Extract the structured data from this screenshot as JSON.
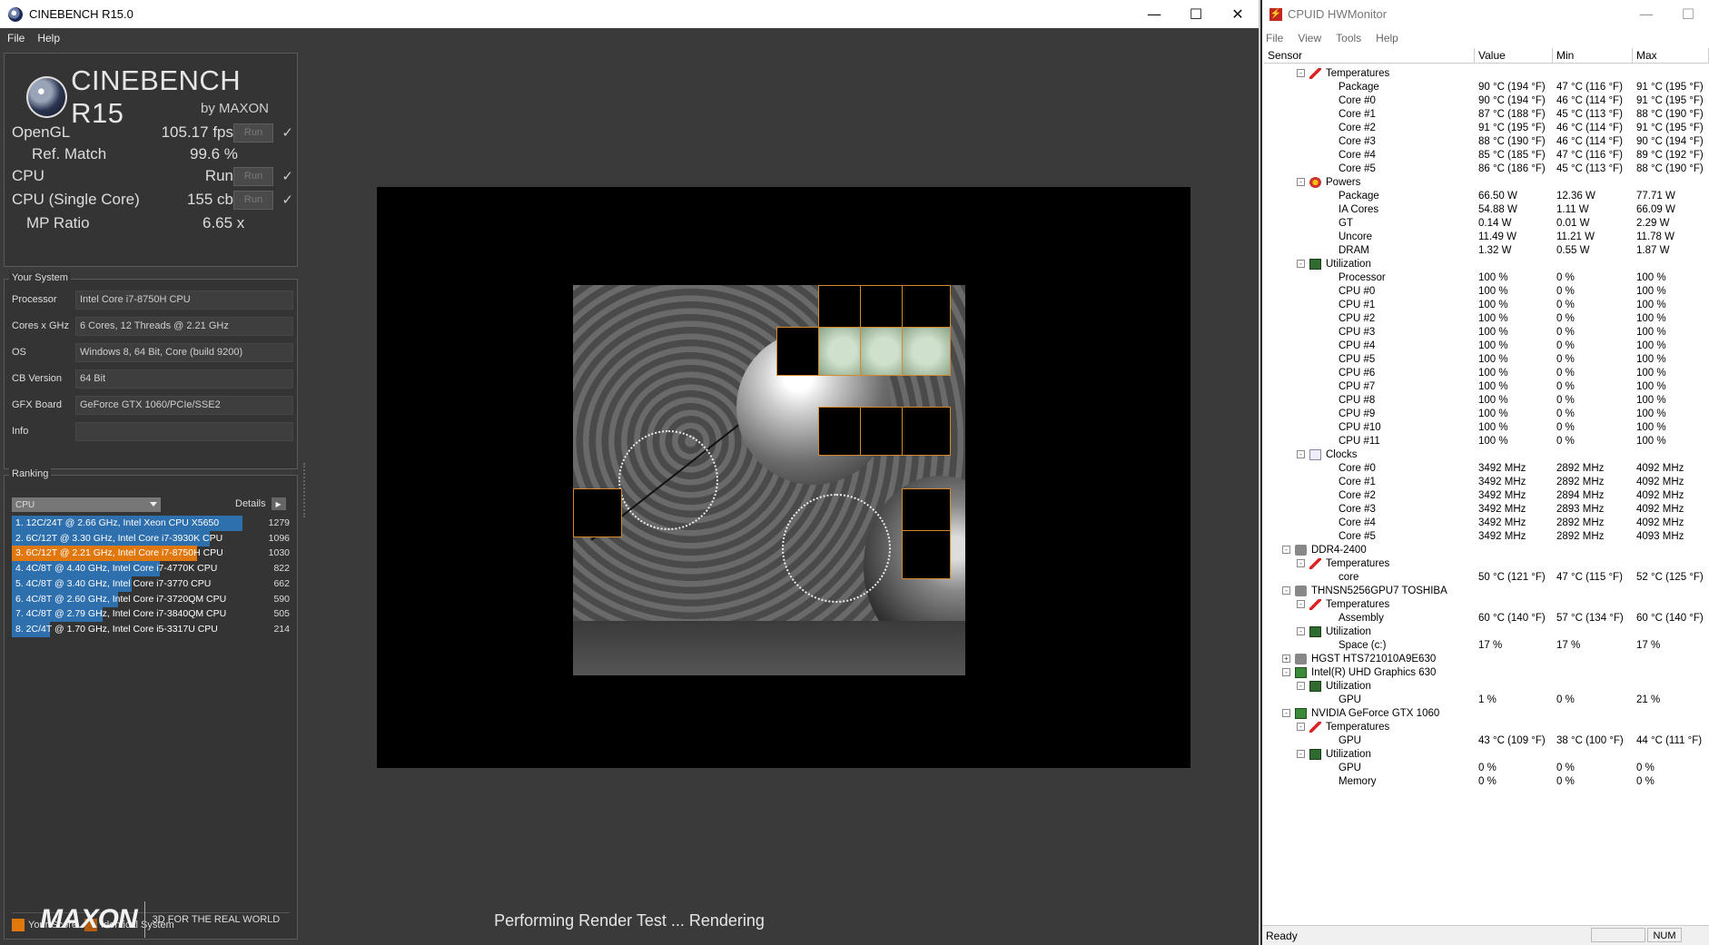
{
  "cinebench": {
    "title": "CINEBENCH R15.0",
    "menu": [
      "File",
      "Help"
    ],
    "logo_text": "CINEBENCH R15",
    "logo_by": "by MAXON",
    "run_label": "Run",
    "results": {
      "opengl_label": "OpenGL",
      "opengl_value": "105.17 fps",
      "refmatch_label": "Ref. Match",
      "refmatch_value": "99.6 %",
      "cpu_label": "CPU",
      "cpu_value": "Run",
      "single_label": "CPU (Single Core)",
      "single_value": "155 cb",
      "mp_label": "MP Ratio",
      "mp_value": "6.65 x"
    },
    "your_system": {
      "title": "Your System",
      "rows": [
        {
          "key": "Processor",
          "value": "Intel Core i7-8750H CPU"
        },
        {
          "key": "Cores x GHz",
          "value": "6 Cores, 12 Threads @ 2.21 GHz"
        },
        {
          "key": "OS",
          "value": "Windows 8, 64 Bit, Core (build 9200)"
        },
        {
          "key": "CB Version",
          "value": "64 Bit"
        },
        {
          "key": "GFX Board",
          "value": "GeForce GTX 1060/PCIe/SSE2"
        },
        {
          "key": "Info",
          "value": ""
        }
      ]
    },
    "ranking": {
      "title": "Ranking",
      "selector": "CPU",
      "details_label": "Details",
      "items": [
        {
          "label": "1. 12C/24T @ 2.66 GHz, Intel Xeon CPU X5650",
          "score": "1279",
          "fraction": 1.0,
          "mine": false
        },
        {
          "label": "2. 6C/12T @ 3.30 GHz,  Intel Core i7-3930K CPU",
          "score": "1096",
          "fraction": 0.857,
          "mine": false
        },
        {
          "label": "3. 6C/12T @ 2.21 GHz, Intel Core i7-8750H CPU",
          "score": "1030",
          "fraction": 0.805,
          "mine": true
        },
        {
          "label": "4. 4C/8T @ 4.40 GHz, Intel Core i7-4770K CPU",
          "score": "822",
          "fraction": 0.643,
          "mine": false
        },
        {
          "label": "5. 4C/8T @ 3.40 GHz,  Intel Core i7-3770 CPU",
          "score": "662",
          "fraction": 0.518,
          "mine": false
        },
        {
          "label": "6. 4C/8T @ 2.60 GHz, Intel Core i7-3720QM CPU",
          "score": "590",
          "fraction": 0.461,
          "mine": false
        },
        {
          "label": "7. 4C/8T @ 2.79 GHz,  Intel Core i7-3840QM CPU",
          "score": "505",
          "fraction": 0.395,
          "mine": false
        },
        {
          "label": "8. 2C/4T @ 1.70 GHz,  Intel Core i5-3317U CPU",
          "score": "214",
          "fraction": 0.167,
          "mine": false
        }
      ],
      "legend_your": "Your Score",
      "legend_identical": "Identical System"
    },
    "footer_brand": "MAXON",
    "footer_tagline": "3D FOR THE REAL WORLD",
    "status": "Performing Render Test ... Rendering",
    "colors": {
      "bar": "#2e6fae",
      "mine": "#e0780e",
      "bg": "#3a3a3a"
    }
  },
  "hwmonitor": {
    "title": "CPUID HWMonitor",
    "menu": [
      "File",
      "View",
      "Tools",
      "Help"
    ],
    "columns": [
      "Sensor",
      "Value",
      "Min",
      "Max"
    ],
    "status": "Ready",
    "num_indicator": "NUM",
    "rows": [
      {
        "indent": 2,
        "toggle": "-",
        "icon": "temp",
        "name": "Temperatures"
      },
      {
        "indent": 3,
        "name": "Package",
        "value": "90 °C  (194 °F)",
        "min": "47 °C  (116 °F)",
        "max": "91 °C  (195 °F)"
      },
      {
        "indent": 3,
        "name": "Core #0",
        "value": "90 °C  (194 °F)",
        "min": "46 °C  (114 °F)",
        "max": "91 °C  (195 °F)"
      },
      {
        "indent": 3,
        "name": "Core #1",
        "value": "87 °C  (188 °F)",
        "min": "45 °C  (113 °F)",
        "max": "88 °C  (190 °F)"
      },
      {
        "indent": 3,
        "name": "Core #2",
        "value": "91 °C  (195 °F)",
        "min": "46 °C  (114 °F)",
        "max": "91 °C  (195 °F)"
      },
      {
        "indent": 3,
        "name": "Core #3",
        "value": "88 °C  (190 °F)",
        "min": "46 °C  (114 °F)",
        "max": "90 °C  (194 °F)"
      },
      {
        "indent": 3,
        "name": "Core #4",
        "value": "85 °C  (185 °F)",
        "min": "47 °C  (116 °F)",
        "max": "89 °C  (192 °F)"
      },
      {
        "indent": 3,
        "name": "Core #5",
        "value": "86 °C  (186 °F)",
        "min": "45 °C  (113 °F)",
        "max": "88 °C  (190 °F)"
      },
      {
        "indent": 2,
        "toggle": "-",
        "icon": "pow",
        "name": "Powers"
      },
      {
        "indent": 3,
        "name": "Package",
        "value": "66.50 W",
        "min": "12.36 W",
        "max": "77.71 W"
      },
      {
        "indent": 3,
        "name": "IA Cores",
        "value": "54.88 W",
        "min": "1.11 W",
        "max": "66.09 W"
      },
      {
        "indent": 3,
        "name": "GT",
        "value": "0.14 W",
        "min": "0.01 W",
        "max": "2.29 W"
      },
      {
        "indent": 3,
        "name": "Uncore",
        "value": "11.49 W",
        "min": "11.21 W",
        "max": "11.78 W"
      },
      {
        "indent": 3,
        "name": "DRAM",
        "value": "1.32 W",
        "min": "0.55 W",
        "max": "1.87 W"
      },
      {
        "indent": 2,
        "toggle": "-",
        "icon": "util",
        "name": "Utilization"
      },
      {
        "indent": 3,
        "name": "Processor",
        "value": "100 %",
        "min": "0 %",
        "max": "100 %"
      },
      {
        "indent": 3,
        "name": "CPU #0",
        "value": "100 %",
        "min": "0 %",
        "max": "100 %"
      },
      {
        "indent": 3,
        "name": "CPU #1",
        "value": "100 %",
        "min": "0 %",
        "max": "100 %"
      },
      {
        "indent": 3,
        "name": "CPU #2",
        "value": "100 %",
        "min": "0 %",
        "max": "100 %"
      },
      {
        "indent": 3,
        "name": "CPU #3",
        "value": "100 %",
        "min": "0 %",
        "max": "100 %"
      },
      {
        "indent": 3,
        "name": "CPU #4",
        "value": "100 %",
        "min": "0 %",
        "max": "100 %"
      },
      {
        "indent": 3,
        "name": "CPU #5",
        "value": "100 %",
        "min": "0 %",
        "max": "100 %"
      },
      {
        "indent": 3,
        "name": "CPU #6",
        "value": "100 %",
        "min": "0 %",
        "max": "100 %"
      },
      {
        "indent": 3,
        "name": "CPU #7",
        "value": "100 %",
        "min": "0 %",
        "max": "100 %"
      },
      {
        "indent": 3,
        "name": "CPU #8",
        "value": "100 %",
        "min": "0 %",
        "max": "100 %"
      },
      {
        "indent": 3,
        "name": "CPU #9",
        "value": "100 %",
        "min": "0 %",
        "max": "100 %"
      },
      {
        "indent": 3,
        "name": "CPU #10",
        "value": "100 %",
        "min": "0 %",
        "max": "100 %"
      },
      {
        "indent": 3,
        "name": "CPU #11",
        "value": "100 %",
        "min": "0 %",
        "max": "100 %"
      },
      {
        "indent": 2,
        "toggle": "-",
        "icon": "clk",
        "name": "Clocks"
      },
      {
        "indent": 3,
        "name": "Core #0",
        "value": "3492 MHz",
        "min": "2892 MHz",
        "max": "4092 MHz"
      },
      {
        "indent": 3,
        "name": "Core #1",
        "value": "3492 MHz",
        "min": "2892 MHz",
        "max": "4092 MHz"
      },
      {
        "indent": 3,
        "name": "Core #2",
        "value": "3492 MHz",
        "min": "2894 MHz",
        "max": "4092 MHz"
      },
      {
        "indent": 3,
        "name": "Core #3",
        "value": "3492 MHz",
        "min": "2893 MHz",
        "max": "4092 MHz"
      },
      {
        "indent": 3,
        "name": "Core #4",
        "value": "3492 MHz",
        "min": "2892 MHz",
        "max": "4092 MHz"
      },
      {
        "indent": 3,
        "name": "Core #5",
        "value": "3492 MHz",
        "min": "2892 MHz",
        "max": "4093 MHz"
      },
      {
        "indent": 1,
        "toggle": "-",
        "icon": "dev",
        "name": "DDR4-2400"
      },
      {
        "indent": 2,
        "toggle": "-",
        "icon": "temp",
        "name": "Temperatures"
      },
      {
        "indent": 3,
        "name": "core",
        "value": "50 °C  (121 °F)",
        "min": "47 °C  (115 °F)",
        "max": "52 °C  (125 °F)"
      },
      {
        "indent": 1,
        "toggle": "-",
        "icon": "dev",
        "name": "THNSN5256GPU7 TOSHIBA"
      },
      {
        "indent": 2,
        "toggle": "-",
        "icon": "temp",
        "name": "Temperatures"
      },
      {
        "indent": 3,
        "name": "Assembly",
        "value": "60 °C  (140 °F)",
        "min": "57 °C  (134 °F)",
        "max": "60 °C  (140 °F)"
      },
      {
        "indent": 2,
        "toggle": "-",
        "icon": "util",
        "name": "Utilization"
      },
      {
        "indent": 3,
        "name": "Space (c:)",
        "value": "17 %",
        "min": "17 %",
        "max": "17 %"
      },
      {
        "indent": 1,
        "toggle": "+",
        "icon": "dev",
        "name": "HGST HTS721010A9E630"
      },
      {
        "indent": 1,
        "toggle": "-",
        "icon": "gpu",
        "name": "Intel(R) UHD Graphics 630"
      },
      {
        "indent": 2,
        "toggle": "-",
        "icon": "util",
        "name": "Utilization"
      },
      {
        "indent": 3,
        "name": "GPU",
        "value": "1 %",
        "min": "0 %",
        "max": "21 %"
      },
      {
        "indent": 1,
        "toggle": "-",
        "icon": "gpu",
        "name": "NVIDIA GeForce GTX 1060"
      },
      {
        "indent": 2,
        "toggle": "-",
        "icon": "temp",
        "name": "Temperatures"
      },
      {
        "indent": 3,
        "name": "GPU",
        "value": "43 °C  (109 °F)",
        "min": "38 °C  (100 °F)",
        "max": "44 °C  (111 °F)"
      },
      {
        "indent": 2,
        "toggle": "-",
        "icon": "util",
        "name": "Utilization"
      },
      {
        "indent": 3,
        "name": "GPU",
        "value": "0 %",
        "min": "0 %",
        "max": "0 %"
      },
      {
        "indent": 3,
        "name": "Memory",
        "value": "0 %",
        "min": "0 %",
        "max": "0 %"
      }
    ]
  }
}
